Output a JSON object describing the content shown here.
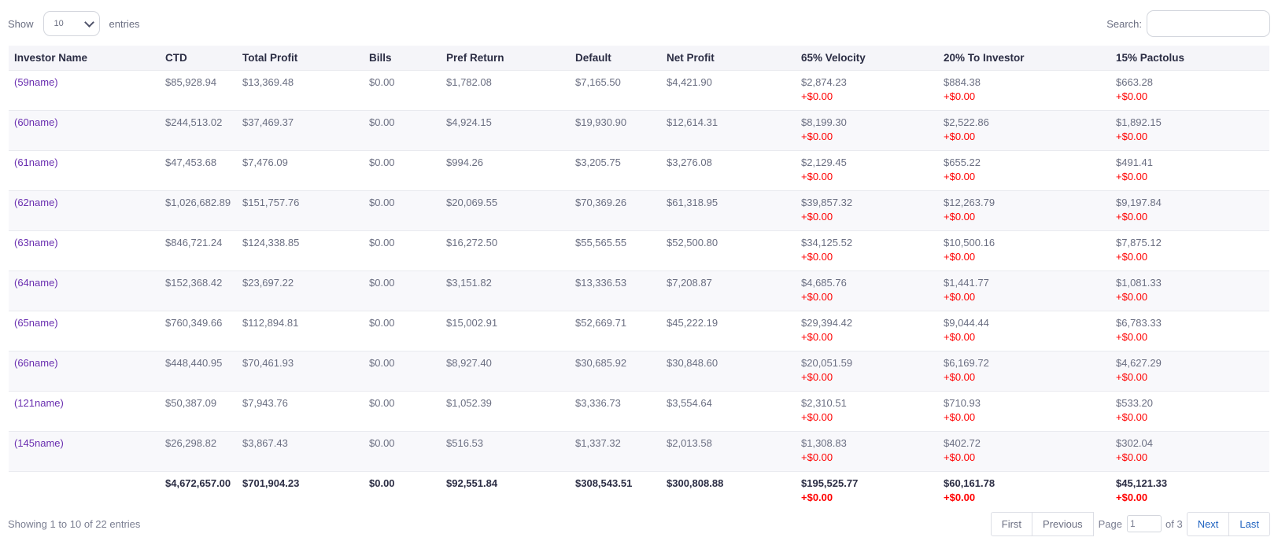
{
  "length": {
    "show_label": "Show",
    "selected": "10",
    "entries_label": "entries"
  },
  "search": {
    "label": "Search:",
    "value": ""
  },
  "table": {
    "columns": [
      "Investor Name",
      "CTD",
      "Total Profit",
      "Bills",
      "Pref Return",
      "Default",
      "Net Profit",
      "65% Velocity",
      "20% To Investor",
      "15% Pactolus"
    ],
    "rows": [
      {
        "name": "(59name)",
        "ctd": "$85,928.94",
        "total_profit": "$13,369.48",
        "bills": "$0.00",
        "pref_return": "$1,782.08",
        "default": "$7,165.50",
        "net_profit": "$4,421.90",
        "velocity": "$2,874.23",
        "velocity_delta": "+$0.00",
        "to_investor": "$884.38",
        "to_investor_delta": "+$0.00",
        "pactolus": "$663.28",
        "pactolus_delta": "+$0.00"
      },
      {
        "name": "(60name)",
        "ctd": "$244,513.02",
        "total_profit": "$37,469.37",
        "bills": "$0.00",
        "pref_return": "$4,924.15",
        "default": "$19,930.90",
        "net_profit": "$12,614.31",
        "velocity": "$8,199.30",
        "velocity_delta": "+$0.00",
        "to_investor": "$2,522.86",
        "to_investor_delta": "+$0.00",
        "pactolus": "$1,892.15",
        "pactolus_delta": "+$0.00"
      },
      {
        "name": "(61name)",
        "ctd": "$47,453.68",
        "total_profit": "$7,476.09",
        "bills": "$0.00",
        "pref_return": "$994.26",
        "default": "$3,205.75",
        "net_profit": "$3,276.08",
        "velocity": "$2,129.45",
        "velocity_delta": "+$0.00",
        "to_investor": "$655.22",
        "to_investor_delta": "+$0.00",
        "pactolus": "$491.41",
        "pactolus_delta": "+$0.00"
      },
      {
        "name": "(62name)",
        "ctd": "$1,026,682.89",
        "total_profit": "$151,757.76",
        "bills": "$0.00",
        "pref_return": "$20,069.55",
        "default": "$70,369.26",
        "net_profit": "$61,318.95",
        "velocity": "$39,857.32",
        "velocity_delta": "+$0.00",
        "to_investor": "$12,263.79",
        "to_investor_delta": "+$0.00",
        "pactolus": "$9,197.84",
        "pactolus_delta": "+$0.00"
      },
      {
        "name": "(63name)",
        "ctd": "$846,721.24",
        "total_profit": "$124,338.85",
        "bills": "$0.00",
        "pref_return": "$16,272.50",
        "default": "$55,565.55",
        "net_profit": "$52,500.80",
        "velocity": "$34,125.52",
        "velocity_delta": "+$0.00",
        "to_investor": "$10,500.16",
        "to_investor_delta": "+$0.00",
        "pactolus": "$7,875.12",
        "pactolus_delta": "+$0.00"
      },
      {
        "name": "(64name)",
        "ctd": "$152,368.42",
        "total_profit": "$23,697.22",
        "bills": "$0.00",
        "pref_return": "$3,151.82",
        "default": "$13,336.53",
        "net_profit": "$7,208.87",
        "velocity": "$4,685.76",
        "velocity_delta": "+$0.00",
        "to_investor": "$1,441.77",
        "to_investor_delta": "+$0.00",
        "pactolus": "$1,081.33",
        "pactolus_delta": "+$0.00"
      },
      {
        "name": "(65name)",
        "ctd": "$760,349.66",
        "total_profit": "$112,894.81",
        "bills": "$0.00",
        "pref_return": "$15,002.91",
        "default": "$52,669.71",
        "net_profit": "$45,222.19",
        "velocity": "$29,394.42",
        "velocity_delta": "+$0.00",
        "to_investor": "$9,044.44",
        "to_investor_delta": "+$0.00",
        "pactolus": "$6,783.33",
        "pactolus_delta": "+$0.00"
      },
      {
        "name": "(66name)",
        "ctd": "$448,440.95",
        "total_profit": "$70,461.93",
        "bills": "$0.00",
        "pref_return": "$8,927.40",
        "default": "$30,685.92",
        "net_profit": "$30,848.60",
        "velocity": "$20,051.59",
        "velocity_delta": "+$0.00",
        "to_investor": "$6,169.72",
        "to_investor_delta": "+$0.00",
        "pactolus": "$4,627.29",
        "pactolus_delta": "+$0.00"
      },
      {
        "name": "(121name)",
        "ctd": "$50,387.09",
        "total_profit": "$7,943.76",
        "bills": "$0.00",
        "pref_return": "$1,052.39",
        "default": "$3,336.73",
        "net_profit": "$3,554.64",
        "velocity": "$2,310.51",
        "velocity_delta": "+$0.00",
        "to_investor": "$710.93",
        "to_investor_delta": "+$0.00",
        "pactolus": "$533.20",
        "pactolus_delta": "+$0.00"
      },
      {
        "name": "(145name)",
        "ctd": "$26,298.82",
        "total_profit": "$3,867.43",
        "bills": "$0.00",
        "pref_return": "$516.53",
        "default": "$1,337.32",
        "net_profit": "$2,013.58",
        "velocity": "$1,308.83",
        "velocity_delta": "+$0.00",
        "to_investor": "$402.72",
        "to_investor_delta": "+$0.00",
        "pactolus": "$302.04",
        "pactolus_delta": "+$0.00"
      }
    ],
    "totals": {
      "name": "",
      "ctd": "$4,672,657.00",
      "total_profit": "$701,904.23",
      "bills": "$0.00",
      "pref_return": "$92,551.84",
      "default": "$308,543.51",
      "net_profit": "$300,808.88",
      "velocity": "$195,525.77",
      "velocity_delta": "+$0.00",
      "to_investor": "$60,161.78",
      "to_investor_delta": "+$0.00",
      "pactolus": "$45,121.33",
      "pactolus_delta": "+$0.00"
    }
  },
  "info": "Showing 1 to 10 of 22 entries",
  "pagination": {
    "first": "First",
    "previous": "Previous",
    "page_label": "Page",
    "page_value": "1",
    "of_label": "of 3",
    "next": "Next",
    "last": "Last"
  },
  "colors": {
    "link": "#6a2fb0",
    "delta": "#ff0000",
    "pager_active": "#1e62c0"
  }
}
